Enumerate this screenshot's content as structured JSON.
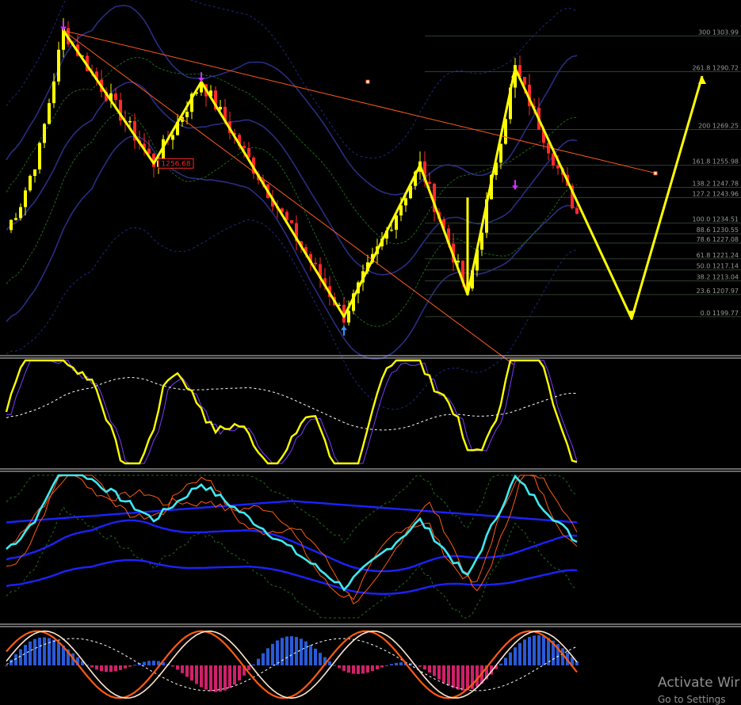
{
  "colors": {
    "background": "#000000",
    "bull": "#ffff00",
    "bear": "#ff2a2a",
    "wave": "#ffff00",
    "trendline": "#ff5a20",
    "band_dark": "#2b2f8a",
    "band_dotted": "#1e2a8a",
    "band_green": "#1f6a1f",
    "fib": "#2f3f2f",
    "oscillator": "#ffff00",
    "osc_signal": "#7a3cff",
    "cyan": "#40e8f0",
    "blue": "#1c22ff",
    "histo_pos": "#2a5ad8",
    "histo_neg": "#d0206a",
    "fast": "#ffe8d0",
    "slow": "#ff5a10"
  },
  "chart_data": [
    {
      "type": "candlestick",
      "title": "",
      "x": "bar index",
      "y": "price",
      "ylim": [
        1190,
        1315
      ],
      "price_marker": "1256.68",
      "zigzag": [
        {
          "bar": 12,
          "price": 1306
        },
        {
          "bar": 31,
          "price": 1256.68
        },
        {
          "bar": 41,
          "price": 1287
        },
        {
          "bar": 71,
          "price": 1199.8
        },
        {
          "bar": 87,
          "price": 1256
        },
        {
          "bar": 97,
          "price": 1208
        },
        {
          "bar": 107,
          "price": 1292
        }
      ],
      "fib_levels": [
        {
          "label": "300 1303.99",
          "price": 1303.99
        },
        {
          "label": "261.8 1290.72",
          "price": 1290.72
        },
        {
          "label": "200 1269.25",
          "price": 1269.25
        },
        {
          "label": "161.8 1255.98",
          "price": 1255.98
        },
        {
          "label": "138.2 1247.78",
          "price": 1247.78
        },
        {
          "label": "127.2 1243.96",
          "price": 1243.96
        },
        {
          "label": "100.0 1234.51",
          "price": 1234.51
        },
        {
          "label": "88.6 1230.55",
          "price": 1230.55
        },
        {
          "label": "78.6 1227.08",
          "price": 1227.08
        },
        {
          "label": "61.8 1221.24",
          "price": 1221.24
        },
        {
          "label": "50.0 1217.14",
          "price": 1217.14
        },
        {
          "label": "38.2 1213.04",
          "price": 1213.04
        },
        {
          "label": "23.6 1207.97",
          "price": 1207.97
        },
        {
          "label": "0.0 1199.77",
          "price": 1199.77
        }
      ]
    },
    {
      "type": "line",
      "title": "",
      "series": [
        {
          "name": ""
        }
      ]
    },
    {
      "type": "line",
      "title": "",
      "series": [
        {
          "name": ""
        }
      ]
    },
    {
      "type": "bar",
      "title": "",
      "series": [
        {
          "name": ""
        }
      ]
    }
  ],
  "watermark": {
    "line1": "Activate Wir",
    "line2": "Go to Settings"
  }
}
